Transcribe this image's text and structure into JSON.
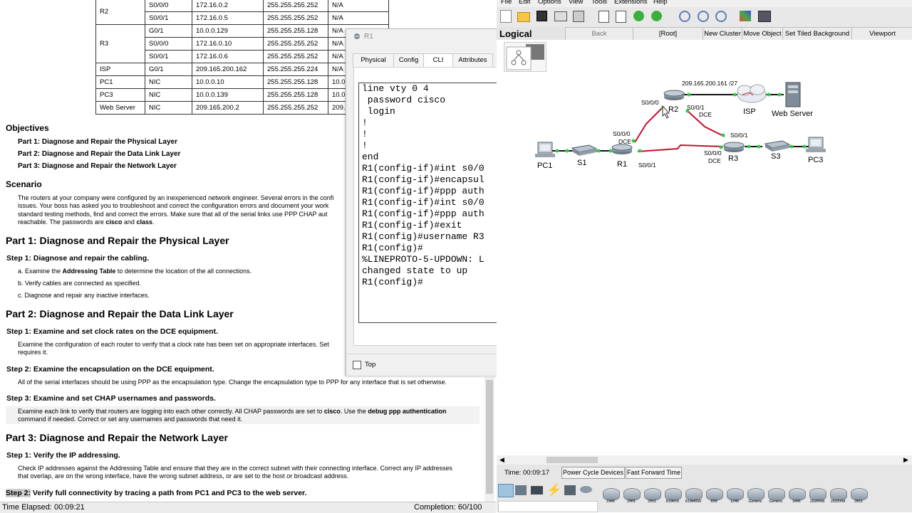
{
  "addressing_table": [
    [
      "R2",
      "S0/0/0",
      "172.16.0.2",
      "255.255.255.252",
      "N/A"
    ],
    [
      "",
      "S0/0/1",
      "172.16.0.5",
      "255.255.255.252",
      "N/A"
    ],
    [
      "",
      "G0/1",
      "10.0.0.129",
      "255.255.255.128",
      "N/A"
    ],
    [
      "R3",
      "S0/0/0",
      "172.16.0.10",
      "255.255.255.252",
      "N/A"
    ],
    [
      "",
      "S0/0/1",
      "172.16.0.6",
      "255.255.255.252",
      "N/A"
    ],
    [
      "ISP",
      "G0/1",
      "209.165.200.162",
      "255.255.255.224",
      "N/A"
    ],
    [
      "PC1",
      "NIC",
      "10.0.0.10",
      "255.255.255.128",
      "10.0."
    ],
    [
      "PC3",
      "NIC",
      "10.0.0.139",
      "255.255.255.128",
      "10.0."
    ],
    [
      "Web Server",
      "NIC",
      "209.165.200.2",
      "255.255.255.252",
      "209.1"
    ]
  ],
  "doc": {
    "objectives_title": "Objectives",
    "objectives": [
      "Part 1: Diagnose and Repair the Physical Layer",
      "Part 2: Diagnose and Repair the Data Link Layer",
      "Part 3: Diagnose and Repair the Network Layer"
    ],
    "scenario_title": "Scenario",
    "scenario_lines": [
      "The routers at your company were configured by an inexperienced network engineer. Several errors in the confi",
      "issues. Your boss has asked you to troubleshoot and correct the configuration errors and document your work",
      "standard testing methods, find and correct the errors. Make sure that all of the serial links use PPP CHAP aut",
      "reachable. The passwords are cisco and class."
    ],
    "part1": "Part 1:  Diagnose and Repair the Physical Layer",
    "p1s1": "Step 1:  Diagnose and repair the cabling.",
    "p1_items": [
      "a.   Examine the Addressing Table to determine the location of the all connections.",
      "b.   Verify cables are connected as specified.",
      "c.   Diagnose and repair any inactive interfaces."
    ],
    "part2": "Part 2:  Diagnose and Repair the Data Link Layer",
    "p2s1": "Step 1:  Examine and set clock rates on the DCE equipment.",
    "p2s1_text": [
      "Examine the configuration of each router to verify that a clock rate has been set on appropriate interfaces. Set",
      "requires it."
    ],
    "p2s2": "Step 2:  Examine the encapsulation on the DCE equipment.",
    "p2s2_text": "All of the serial interfaces should be using PPP as the encapsulation type. Change the encapsulation type to PPP for any interface that is set otherwise.",
    "p2s3": "Step 3:  Examine and set CHAP usernames and passwords.",
    "p2s3_text": [
      "Examine each link to verify that routers are logging into each other correctly. All CHAP passwords are set to cisco. Use the debug ppp authentication",
      "command if needed. Correct or set any usernames and passwords that need it."
    ],
    "part3": "Part 3:  Diagnose and Repair the Network Layer",
    "p3s1": "Step 1:  Verify the IP addressing.",
    "p3s1_text": [
      "Check IP addresses against the Addressing Table and ensure that they are in the correct subnet with their connecting interface. Correct any IP addresses",
      "that overlap, are on the wrong interface, have the wrong subnet address, or are set to the host or broadcast address."
    ],
    "p3s2_label": "Step 2:",
    "p3s2_rest": " Verify full connectivity by tracing a path from PC1 and PC3 to the web server."
  },
  "status": {
    "time_elapsed": "Time Elapsed: 00:09:21",
    "completion": "Completion: 60/100"
  },
  "r1_window": {
    "title": "R1",
    "tabs": [
      "Physical",
      "Config",
      "CLI",
      "Attributes"
    ],
    "active_tab": "CLI",
    "cli_lines": [
      "line vty 0 4",
      " password cisco",
      " login",
      "!",
      "!",
      "!",
      "end",
      "",
      "",
      "R1(config-if)#int s0/0",
      "R1(config-if)#encapsul",
      "R1(config-if)#ppp auth",
      "R1(config-if)#int s0/0",
      "R1(config-if)#ppp auth",
      "R1(config-if)#exit",
      "R1(config)#username R3",
      "R1(config)#",
      "%LINEPROTO-5-UPDOWN: L",
      "changed state to up",
      "",
      "R1(config)#"
    ],
    "top_checkbox": "Top"
  },
  "pt": {
    "menu": [
      "File",
      "Edit",
      "Options",
      "View",
      "Tools",
      "Extensions",
      "Help"
    ],
    "logical": "Logical",
    "logical_buttons": [
      "Back",
      "[Root]",
      "New Cluster",
      "Move Object",
      "Set Tiled Background",
      "Viewport"
    ],
    "time": "Time: 00:09:17",
    "power_cycle": "Power Cycle Devices",
    "fast_forward": "Fast Forward Time",
    "device_models": [
      "1941",
      "2901",
      "2911",
      "819IOX",
      "819HGW",
      "829",
      "1240",
      "Generic",
      "Generic",
      "1841",
      "2620XM",
      "2621XM",
      "2811"
    ],
    "topology": {
      "nodes": [
        "PC1",
        "S1",
        "R1",
        "R2",
        "ISP",
        "Web Server",
        "R3",
        "S3",
        "PC3"
      ],
      "port_labels": [
        "S0/0/0",
        "S0/0/1",
        "DCE",
        "S0/0/0",
        "DCE",
        "S0/0/1",
        "S0/0/1",
        "S0/0/0",
        "DCE"
      ],
      "isp_ip": "209.165.200.161 /27"
    }
  }
}
